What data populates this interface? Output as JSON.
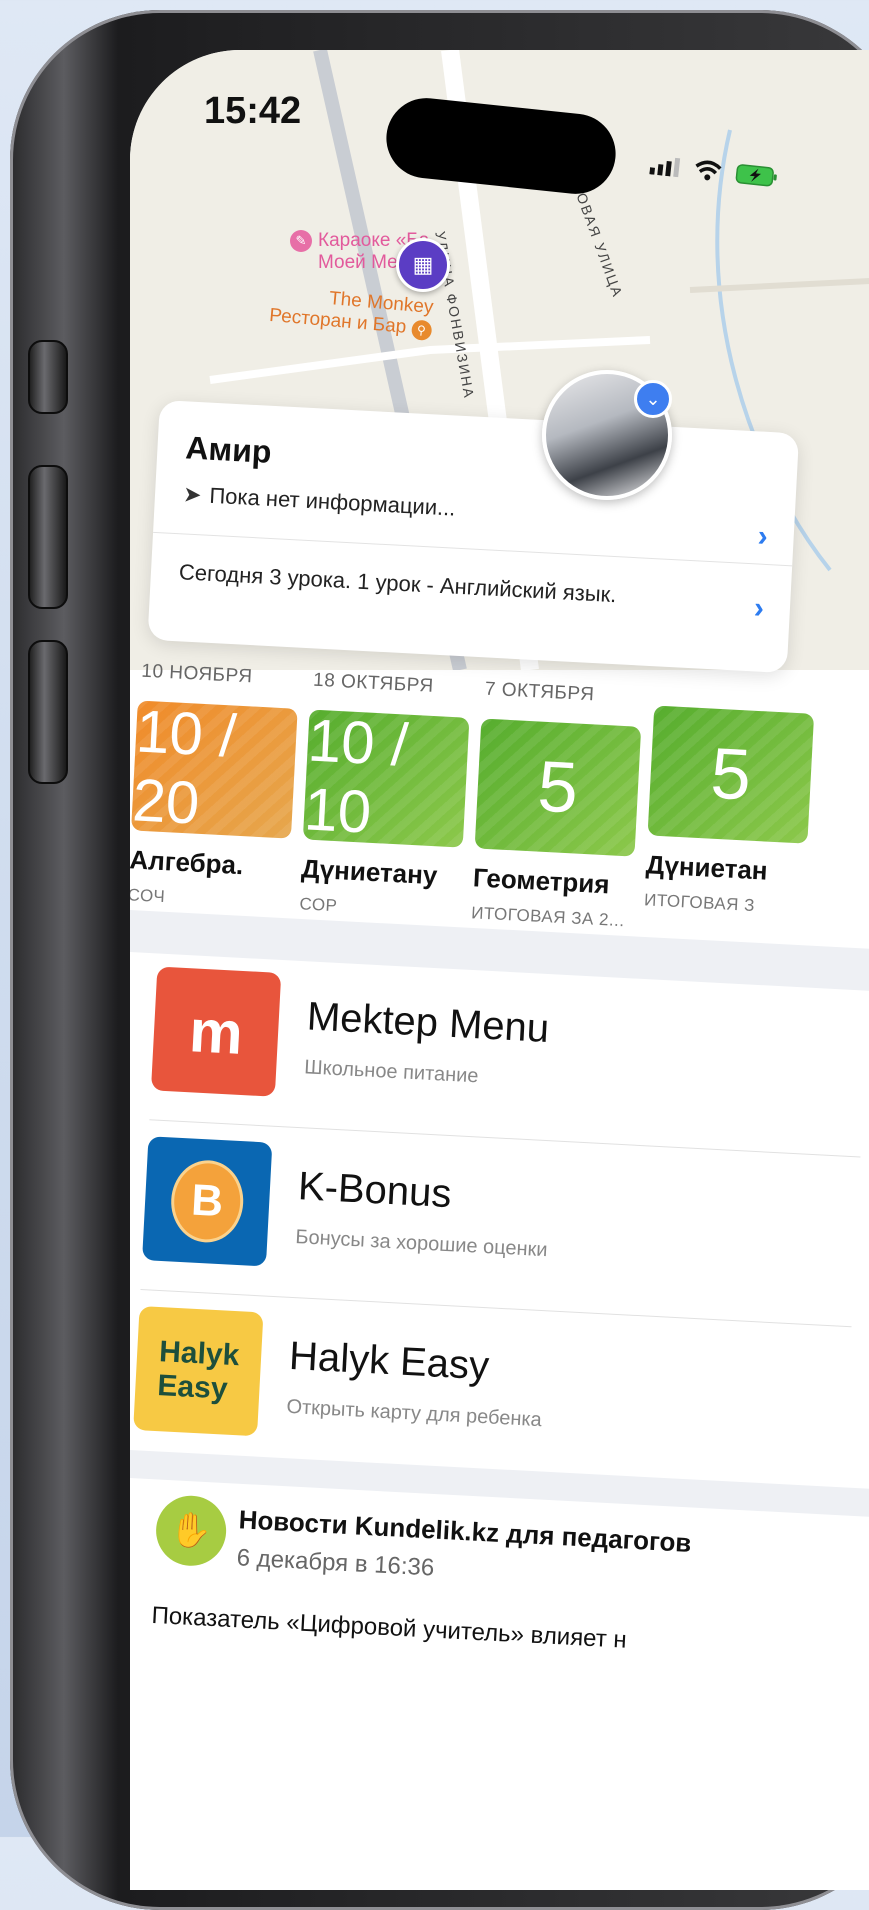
{
  "status_bar": {
    "time": "15:42"
  },
  "map": {
    "street_1": "УЛИЦА ФОНВИЗИНА",
    "street_2": "БЕРЕГОВАЯ УЛИЦА",
    "poi_1": "Караоке «Ба",
    "poi_1_line2": "Моей Ме",
    "poi_2": "The Monkey",
    "poi_2_line2": "Ресторан и Бар"
  },
  "student_card": {
    "name": "Амир",
    "location": "Пока нет информации...",
    "lessons_today": "Сегодня 3 урока. 1 урок - Английский язык."
  },
  "grades": [
    {
      "date": "10 НОЯБРЯ",
      "score": "10 / 20",
      "subject": "Алгебра.",
      "type": "СОЧ",
      "color": "#f08b2a"
    },
    {
      "date": "18 ОКТЯБРЯ",
      "score": "10 / 10",
      "subject": "Дүниетану",
      "type": "СОР",
      "color": "#56ad2e"
    },
    {
      "date": "7 ОКТЯБРЯ",
      "score": "5",
      "subject": "Геометрия",
      "type": "ИТОГОВАЯ ЗА 2...",
      "color": "#56ad2e"
    },
    {
      "date": "",
      "score": "5",
      "subject": "Дүниетан",
      "type": "ИТОГОВАЯ З",
      "color": "#56ad2e"
    }
  ],
  "apps": [
    {
      "title": "Mektep Menu",
      "subtitle": "Школьное питание",
      "icon": "mektep-logo",
      "icon_text": "m",
      "color": "#e8553c"
    },
    {
      "title": "K-Bonus",
      "subtitle": "Бонусы за хорошие оценки",
      "icon": "k-bonus-logo",
      "icon_text": "B",
      "color": "#0a67b2"
    },
    {
      "title": "Halyk Easy",
      "subtitle": "Открыть карту для ребенка",
      "icon": "halyk-easy-logo",
      "icon_text": "Halyk Easy",
      "color": "#f7c944"
    }
  ],
  "news": {
    "source": "Новости Kundelik.kz для педагогов",
    "date": "6 декабря в 16:36",
    "text": "Показатель «Цифровой учитель» влияет н"
  }
}
